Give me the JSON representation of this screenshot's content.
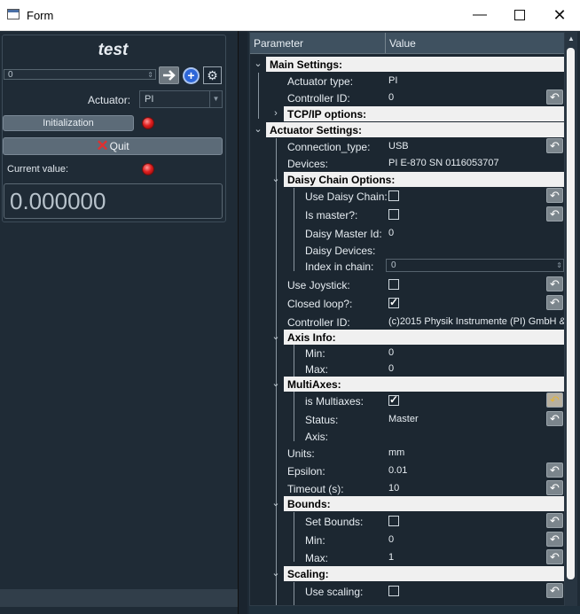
{
  "window": {
    "title": "Form"
  },
  "left": {
    "title": "test",
    "combo1_value": "0",
    "actuator_label": "Actuator:",
    "actuator_value": "PI",
    "init_label": "Initialization",
    "quit_label": "Quit",
    "current_label": "Current value:",
    "current_value": "0.000000"
  },
  "tree": {
    "header_param": "Parameter",
    "header_value": "Value",
    "main_settings": "Main Settings:",
    "actuator_type": {
      "label": "Actuator type:",
      "value": "PI"
    },
    "controller_id1": {
      "label": "Controller ID:",
      "value": "0"
    },
    "tcpip": "TCP/IP options:",
    "actuator_settings": "Actuator Settings:",
    "connection_type": {
      "label": "Connection_type:",
      "value": "USB"
    },
    "devices": {
      "label": "Devices:",
      "value": "PI E-870 SN 0116053707"
    },
    "daisy_options": "Daisy Chain Options:",
    "use_daisy": {
      "label": "Use Daisy Chain:"
    },
    "is_master": {
      "label": "Is master?:"
    },
    "daisy_master_id": {
      "label": "Daisy Master Id:",
      "value": "0"
    },
    "daisy_devices": {
      "label": "Daisy Devices:"
    },
    "index_in_chain": {
      "label": "Index in chain:",
      "value": "0"
    },
    "use_joystick": {
      "label": "Use Joystick:"
    },
    "closed_loop": {
      "label": "Closed loop?:"
    },
    "controller_id2": {
      "label": "Controller ID:",
      "value": "(c)2015 Physik Instrumente (PI) GmbH &"
    },
    "axis_info": "Axis Info:",
    "axis_min": {
      "label": "Min:",
      "value": "0"
    },
    "axis_max": {
      "label": "Max:",
      "value": "0"
    },
    "multiaxes": "MultiAxes:",
    "is_multiaxes": {
      "label": "is Multiaxes:"
    },
    "status": {
      "label": "Status:",
      "value": "Master"
    },
    "axis": {
      "label": "Axis:"
    },
    "units": {
      "label": "Units:",
      "value": "mm"
    },
    "epsilon": {
      "label": "Epsilon:",
      "value": "0.01"
    },
    "timeout": {
      "label": "Timeout (s):",
      "value": "10"
    },
    "bounds": "Bounds:",
    "set_bounds": {
      "label": "Set Bounds:"
    },
    "bounds_min": {
      "label": "Min:",
      "value": "0"
    },
    "bounds_max": {
      "label": "Max:",
      "value": "1"
    },
    "scaling": "Scaling:",
    "use_scaling": {
      "label": "Use scaling:"
    }
  },
  "colors": {
    "background": "#1e2a35",
    "group_band": "#f0f0f0",
    "header": "#3f5160",
    "led": "#e02020"
  },
  "icons": [
    "arrow-right-icon",
    "plus-icon",
    "gear-icon",
    "reset-icon",
    "close-icon"
  ]
}
